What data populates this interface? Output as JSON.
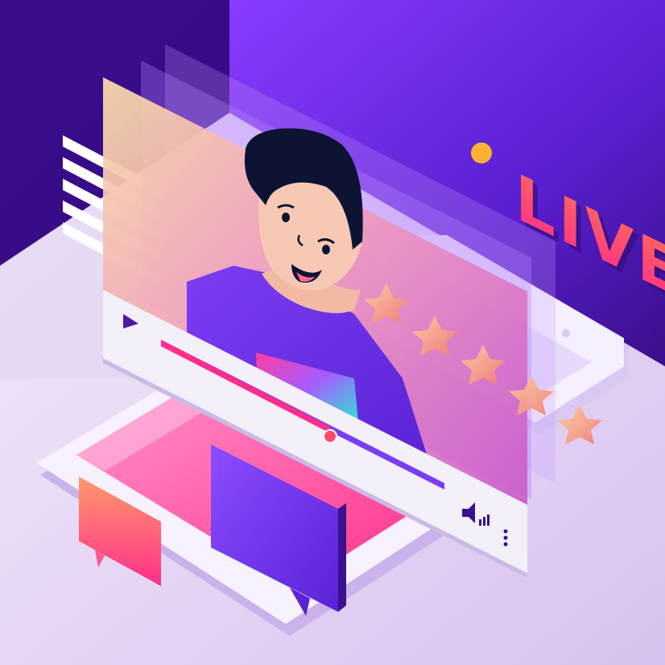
{
  "live_badge": {
    "text": "LIVE",
    "color": "#ff3d8b",
    "dot_color": "#f9b233"
  },
  "video_player": {
    "progress_fraction": 0.62,
    "rating_stars": 5,
    "icons": [
      "play-icon",
      "volume-icon",
      "more-options-icon"
    ]
  },
  "colors": {
    "background_dark": "#2a0a6b",
    "wall_violet": "#7b2cf0",
    "floor_light": "#e9dcf5",
    "progress_accent": "#ff2e8a",
    "shirt": "#6a2ee0",
    "hair": "#0d1433",
    "skin": "#f7c9b5"
  }
}
